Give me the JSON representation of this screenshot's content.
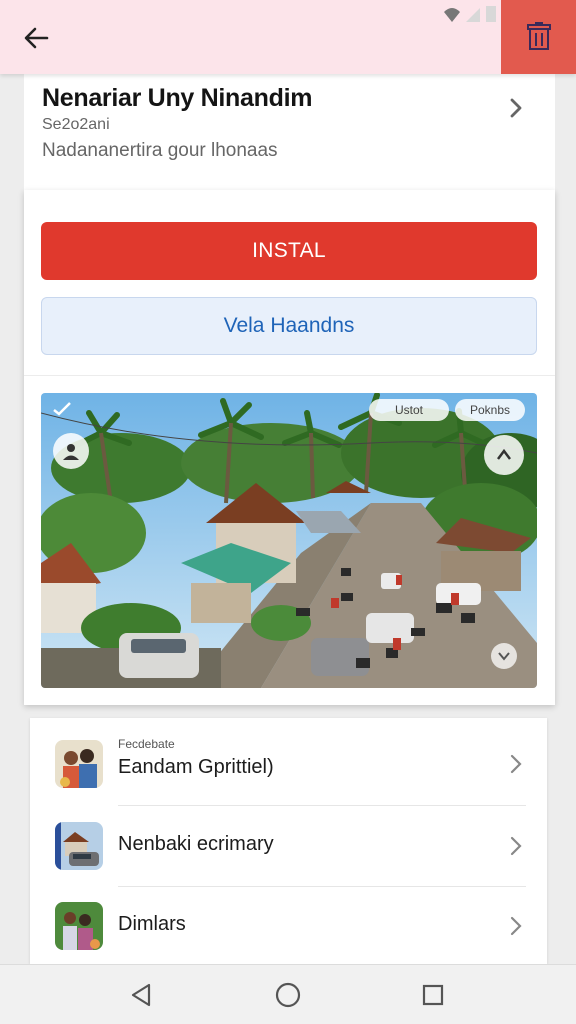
{
  "header": {
    "back_icon": "arrow-left-icon",
    "action_icon": "trash-icon",
    "accent_color": "#e25a4e"
  },
  "app": {
    "title": "Nenariar Uny Ninandim",
    "subtitle": "Se2o2ani",
    "description": "Nadananertira gour lhonaas"
  },
  "actions": {
    "install_label": "INSTAL",
    "secondary_label": "Vela Haandns",
    "install_color": "#e0392d"
  },
  "photo": {
    "chip_left": "Ustot",
    "chip_right": "Poknbs"
  },
  "list": {
    "items": [
      {
        "small": "Fecdebate",
        "title": "Eandam Gprittiel)",
        "thumb": "people-thumbnail"
      },
      {
        "small": "",
        "title": "Nenbaki ecrimary",
        "thumb": "house-car-thumbnail"
      },
      {
        "small": "",
        "title": "Dimlars",
        "thumb": "family-thumbnail"
      }
    ]
  },
  "navbar": {
    "back_icon": "nav-back-icon",
    "home_icon": "nav-home-icon",
    "recents_icon": "nav-recents-icon"
  }
}
